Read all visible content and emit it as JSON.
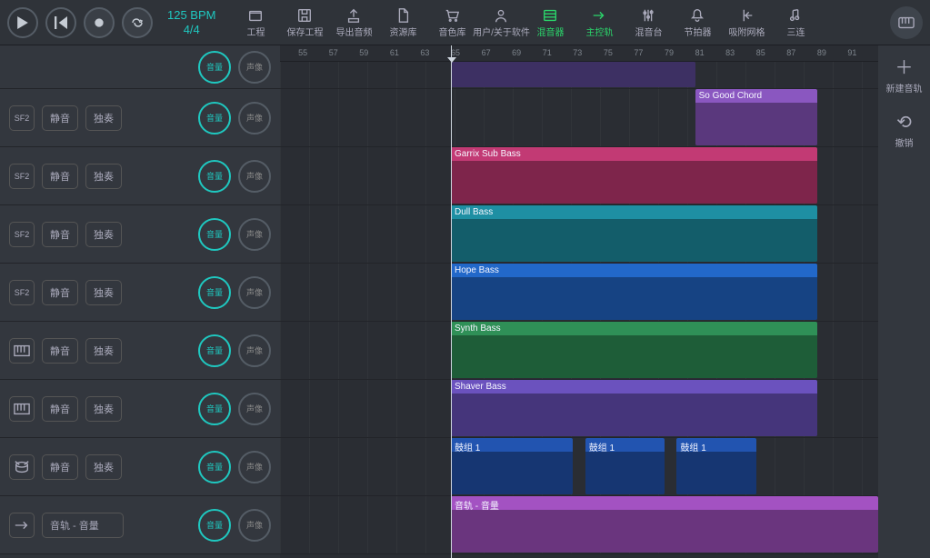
{
  "tempo": {
    "bpm_label": "125 BPM",
    "sig": "4/4"
  },
  "tools": [
    {
      "id": "project",
      "label": "工程",
      "icon": "folder"
    },
    {
      "id": "save",
      "label": "保存工程",
      "icon": "save"
    },
    {
      "id": "export",
      "label": "导出音频",
      "icon": "upload"
    },
    {
      "id": "browser",
      "label": "资源库",
      "icon": "file"
    },
    {
      "id": "sounds",
      "label": "音色库",
      "icon": "cart"
    },
    {
      "id": "about",
      "label": "用户/关于软件",
      "icon": "user"
    },
    {
      "id": "mixer",
      "label": "混音器",
      "icon": "mixer",
      "active": true
    },
    {
      "id": "master",
      "label": "主控轨",
      "icon": "send",
      "active": true
    },
    {
      "id": "console",
      "label": "混音台",
      "icon": "sliders"
    },
    {
      "id": "metronome",
      "label": "节拍器",
      "icon": "bell"
    },
    {
      "id": "snap",
      "label": "吸附网格",
      "icon": "snapleft"
    },
    {
      "id": "tempo",
      "label": "三连",
      "icon": "notes"
    }
  ],
  "ruler": {
    "start": 53.8,
    "end": 93,
    "step": 2
  },
  "playhead_bar": 65,
  "track_buttons": {
    "mute": "静音",
    "solo": "独奏",
    "vol": "音量",
    "pan": "声像"
  },
  "tracks": [
    {
      "type": "",
      "first": true
    },
    {
      "type": "SF2"
    },
    {
      "type": "SF2"
    },
    {
      "type": "SF2"
    },
    {
      "type": "SF2"
    },
    {
      "type": "KEYS"
    },
    {
      "type": "KEYS"
    },
    {
      "type": "DRUM"
    },
    {
      "type": "SEND",
      "last": true,
      "label": "音轨 - 音量"
    }
  ],
  "clips": [
    {
      "lane": 0,
      "name": "",
      "start": 65,
      "end": 81,
      "color": "#5e4b99",
      "nolabel": true
    },
    {
      "lane": 1,
      "name": "So Good Chord",
      "start": 81,
      "end": 89,
      "color": "#8a57c0"
    },
    {
      "lane": 2,
      "name": "Garrix Sub Bass",
      "start": 65,
      "end": 89,
      "color": "#c23a74"
    },
    {
      "lane": 3,
      "name": "Dull Bass",
      "start": 65,
      "end": 89,
      "color": "#1e8fa3"
    },
    {
      "lane": 4,
      "name": "Hope Bass",
      "start": 65,
      "end": 89,
      "color": "#2268c9"
    },
    {
      "lane": 5,
      "name": "Synth Bass",
      "start": 65,
      "end": 89,
      "color": "#2f9057"
    },
    {
      "lane": 6,
      "name": "Shaver Bass",
      "start": 65,
      "end": 89,
      "color": "#6b52be"
    },
    {
      "lane": 7,
      "name": "鼓组 1",
      "start": 65,
      "end": 73,
      "color": "#2254b0"
    },
    {
      "lane": 7,
      "name": "鼓组 1",
      "start": 73.8,
      "end": 79,
      "color": "#2254b0"
    },
    {
      "lane": 7,
      "name": "鼓组 1",
      "start": 79.8,
      "end": 85,
      "color": "#2254b0"
    },
    {
      "lane": 8,
      "name": "音轨 - 音量",
      "start": 65,
      "end": 93,
      "color": "#a352c2"
    }
  ],
  "right": {
    "new_track": "新建音轨",
    "undo": "撤销"
  }
}
